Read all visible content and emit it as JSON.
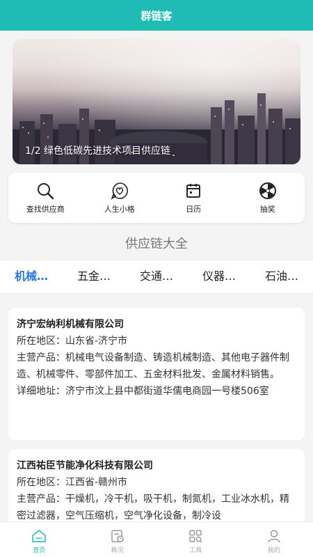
{
  "header": {
    "title": "群链客"
  },
  "banner": {
    "caption": "1/2  绿色低碳先进技术项目供应链"
  },
  "quick_actions": [
    {
      "label": "查找供应商",
      "icon": "search-icon"
    },
    {
      "label": "人生小格",
      "icon": "heart-chat-icon"
    },
    {
      "label": "日历",
      "icon": "calendar-icon"
    },
    {
      "label": "抽奖",
      "icon": "lottery-wheel-icon"
    }
  ],
  "section": {
    "title": "供应链大全"
  },
  "tabs": [
    "机械…",
    "五金…",
    "交通…",
    "仪器…",
    "石油…"
  ],
  "companies": [
    {
      "name": "济宁宏纳利机械有限公司",
      "region_label": "所在地区：",
      "region": "山东省-济宁市",
      "products_label": "主营产品：",
      "products": "机械电气设备制造、铸造机械制造、其他电子器件制造、机械零件、零部件加工、五金材料批发、金属材料销售。",
      "address_label": "详细地址：",
      "address": "济宁市汶上县中都街道华儒电商园一号楼506室"
    },
    {
      "name": "江西祐臣节能净化科技有限公司",
      "region_label": "所在地区：",
      "region": "江西省-赣州市",
      "products_label": "主营产品：",
      "products": "干燥机，冷干机，吸干机，制氮机，工业冰水机，精密过滤器，空气压缩机，空气净化设备，制冷设"
    }
  ],
  "bottom_nav": [
    {
      "label": "首页",
      "icon": "home-icon",
      "active": true
    },
    {
      "label": "概况",
      "icon": "overview-icon"
    },
    {
      "label": "工具",
      "icon": "tools-icon"
    },
    {
      "label": "我的",
      "icon": "user-icon"
    }
  ],
  "colors": {
    "primary": "#1fbcb5",
    "tab_active": "#2a78d6"
  }
}
